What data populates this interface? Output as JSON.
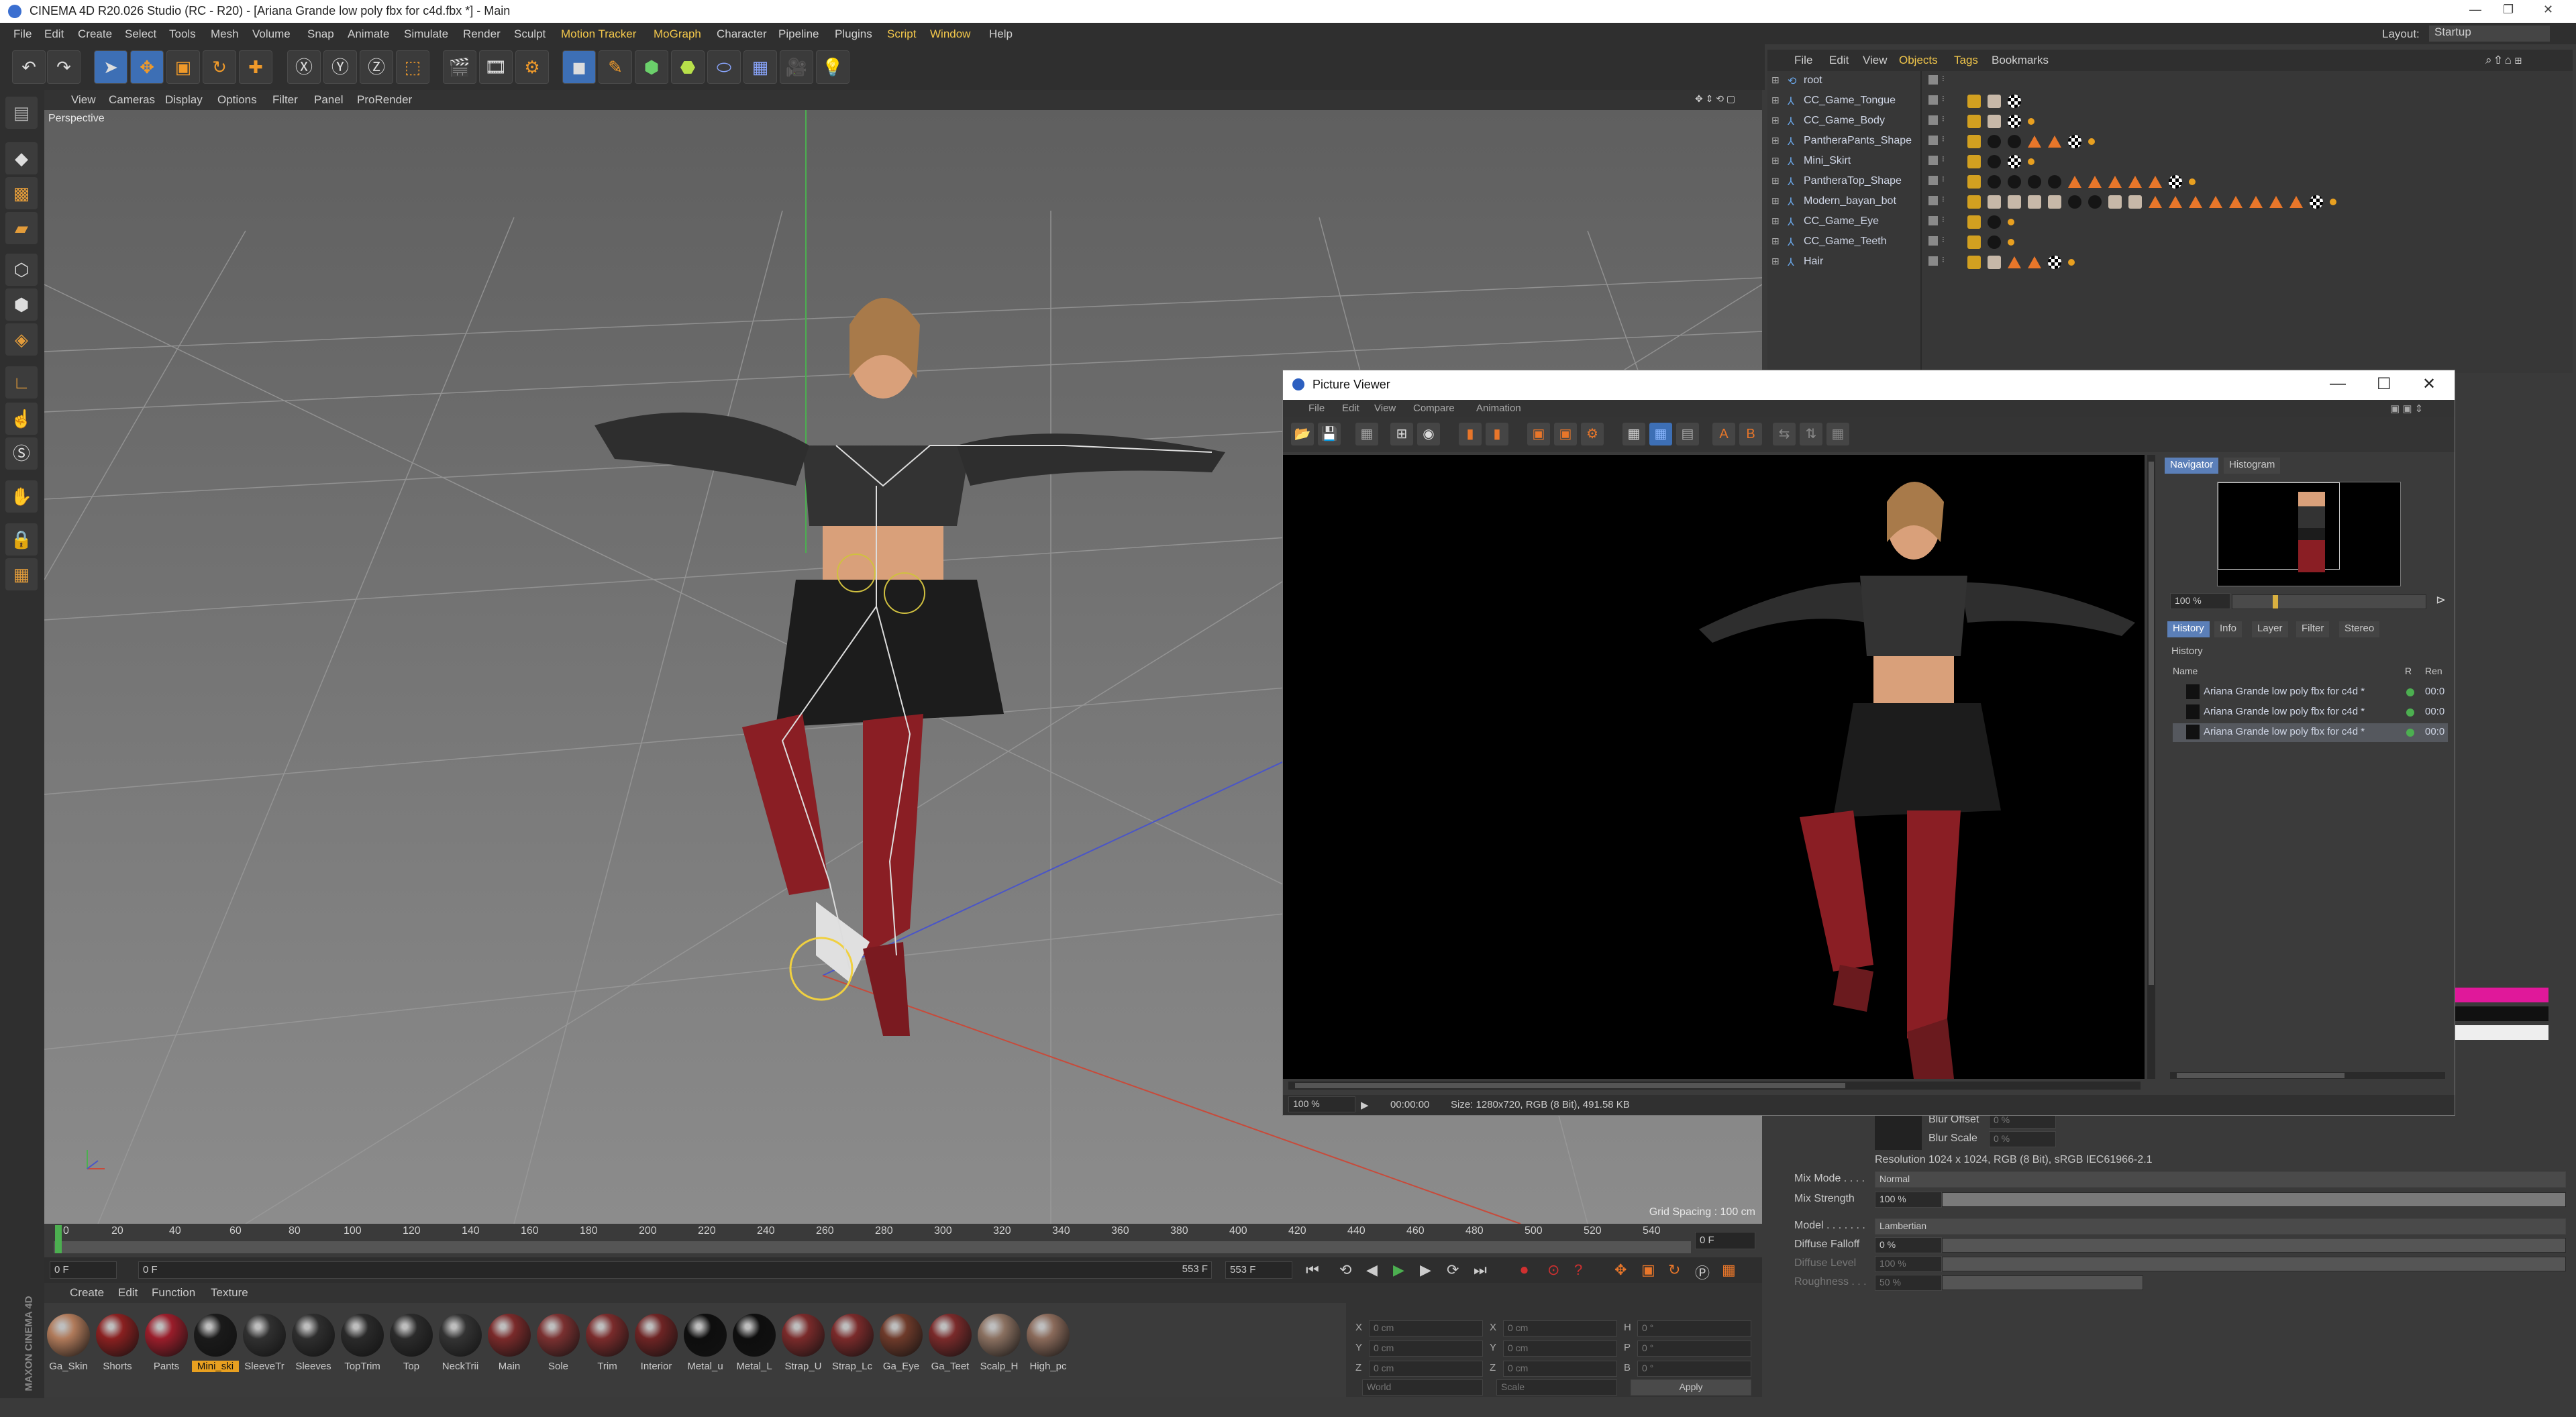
{
  "window": {
    "title": "CINEMA 4D R20.026 Studio (RC - R20) - [Ariana Grande low poly fbx for c4d.fbx *] - Main"
  },
  "menu": [
    "File",
    "Edit",
    "Create",
    "Select",
    "Tools",
    "Mesh",
    "Volume",
    "Snap",
    "Animate",
    "Simulate",
    "Render",
    "Sculpt",
    "Motion Tracker",
    "MoGraph",
    "Character",
    "Pipeline",
    "Plugins",
    "Script",
    "Window",
    "Help"
  ],
  "layout": {
    "label": "Layout:",
    "value": "Startup"
  },
  "viewport": {
    "menu": [
      "View",
      "Cameras",
      "Display",
      "Options",
      "Filter",
      "Panel",
      "ProRender"
    ],
    "camera_label": "Perspective",
    "grid_spacing": "Grid Spacing : 100 cm"
  },
  "timeline": {
    "ticks": [
      "0",
      "20",
      "40",
      "60",
      "80",
      "100",
      "120",
      "140",
      "160",
      "180",
      "200",
      "220",
      "240",
      "260",
      "280",
      "300",
      "320",
      "340",
      "360",
      "380",
      "400",
      "420",
      "440",
      "460",
      "480",
      "500",
      "520",
      "540"
    ],
    "frame_end": "0 F",
    "current": "0 F",
    "start": "0 F",
    "end_a": "553 F",
    "end_b": "553 F"
  },
  "materials": {
    "menu": [
      "Create",
      "Edit",
      "Function",
      "Texture"
    ],
    "items": [
      {
        "name": "Ga_Skin",
        "color": "#b07a5a"
      },
      {
        "name": "Shorts",
        "color": "#8a2020"
      },
      {
        "name": "Pants",
        "color": "#9a1d2a"
      },
      {
        "name": "Mini_ski",
        "color": "#1a1a1a"
      },
      {
        "name": "SleeveTr",
        "color": "#303030"
      },
      {
        "name": "Sleeves",
        "color": "#2e2e2e"
      },
      {
        "name": "TopTrim",
        "color": "#2a2a2a"
      },
      {
        "name": "Top",
        "color": "#2b2b2b"
      },
      {
        "name": "NeckTrii",
        "color": "#333333"
      },
      {
        "name": "Main",
        "color": "#7a2a2a"
      },
      {
        "name": "Sole",
        "color": "#7a3030"
      },
      {
        "name": "Trim",
        "color": "#7a2b2b"
      },
      {
        "name": "Interior",
        "color": "#6e2424"
      },
      {
        "name": "Metal_u",
        "color": "#0e0e0e"
      },
      {
        "name": "Metal_L",
        "color": "#0e0e0e"
      },
      {
        "name": "Strap_U",
        "color": "#7a2a2a"
      },
      {
        "name": "Strap_Lc",
        "color": "#7a2a2a"
      },
      {
        "name": "Ga_Eye",
        "color": "#6e3a2a"
      },
      {
        "name": "Ga_Teet",
        "color": "#7a2a2a"
      },
      {
        "name": "Scalp_H",
        "color": "#8a7060"
      },
      {
        "name": "High_pc",
        "color": "#8a6a5a"
      }
    ]
  },
  "coordinates": {
    "rows": [
      {
        "axis": "X",
        "pos": "0 cm",
        "axis2": "X",
        "size": "0 cm",
        "axis3": "H",
        "rot": "0 °"
      },
      {
        "axis": "Y",
        "pos": "0 cm",
        "axis2": "Y",
        "size": "0 cm",
        "axis3": "P",
        "rot": "0 °"
      },
      {
        "axis": "Z",
        "pos": "0 cm",
        "axis2": "Z",
        "size": "0 cm",
        "axis3": "B",
        "rot": "0 °"
      }
    ],
    "mode1": "World",
    "mode2": "Scale",
    "apply": "Apply"
  },
  "objects": {
    "menu": [
      "File",
      "Edit",
      "View",
      "Objects",
      "Tags",
      "Bookmarks"
    ],
    "items": [
      "root",
      "CC_Game_Tongue",
      "CC_Game_Body",
      "PantheraPants_Shape",
      "Mini_Skirt",
      "PantheraTop_Shape",
      "Modern_bayan_bot",
      "CC_Game_Eye",
      "CC_Game_Teeth",
      "Hair"
    ]
  },
  "picture_viewer": {
    "title": "Picture Viewer",
    "menu": [
      "File",
      "Edit",
      "View",
      "Compare",
      "Animation"
    ],
    "tabs_top": [
      "Navigator",
      "Histogram"
    ],
    "nav_zoom": "100 %",
    "tabs_bottom": [
      "History",
      "Info",
      "Layer",
      "Filter",
      "Stereo"
    ],
    "history_label": "History",
    "col_name": "Name",
    "col_r": "R",
    "col_ren": "Ren",
    "history_rows": [
      {
        "name": "Ariana Grande low poly fbx for c4d *",
        "time": "00:0"
      },
      {
        "name": "Ariana Grande low poly fbx for c4d *",
        "time": "00:0"
      },
      {
        "name": "Ariana Grande low poly fbx for c4d *",
        "time": "00:0"
      }
    ],
    "status_zoom": "100 %",
    "status_time": "00:00:00",
    "status_size": "Size: 1280x720, RGB (8 Bit), 491.58 KB"
  },
  "attributes": {
    "blur_offset": {
      "label": "Blur Offset",
      "value": "0 %"
    },
    "blur_scale": {
      "label": "Blur Scale",
      "value": "0 %"
    },
    "resolution": "Resolution 1024 x 1024, RGB (8 Bit), sRGB IEC61966-2.1",
    "mix_mode": {
      "label": "Mix Mode . . . .",
      "value": "Normal"
    },
    "mix_strength": {
      "label": "Mix Strength",
      "value": "100 %"
    },
    "model": {
      "label": "Model . . . . . . .",
      "value": "Lambertian"
    },
    "diffuse_falloff": {
      "label": "Diffuse Falloff",
      "value": "0 %"
    },
    "diffuse_level": {
      "label": "Diffuse Level",
      "value": "100 %"
    },
    "roughness": {
      "label": "Roughness . . .",
      "value": "50 %"
    }
  },
  "brand": "MAXON CINEMA 4D"
}
